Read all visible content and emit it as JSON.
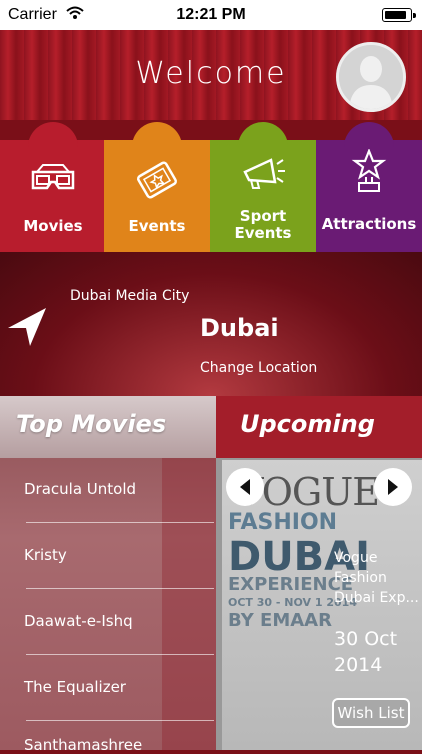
{
  "status": {
    "carrier": "Carrier",
    "time": "12:21 PM",
    "battery_level": 0.9
  },
  "header": {
    "title": "Welcome"
  },
  "categories": [
    {
      "label": "Movies",
      "icon": "3d-glasses-icon"
    },
    {
      "label": "Events",
      "icon": "ticket-icon"
    },
    {
      "label": "Sport Events",
      "icon": "megaphone-icon"
    },
    {
      "label": "Attractions",
      "icon": "star-trophy-icon"
    }
  ],
  "location": {
    "area": "Dubai Media City",
    "city": "Dubai",
    "change_label": "Change Location"
  },
  "top_movies": {
    "title": "Top Movies",
    "items": [
      "Dracula Untold",
      "Kristy",
      "Daawat-e-Ishq",
      "The Equalizer",
      "Santhamashree"
    ]
  },
  "upcoming": {
    "title": "Upcoming",
    "event": {
      "title": "Vogue Fashion Dubai Exp...",
      "date": "30 Oct 2014",
      "wish_label": "Wish List"
    },
    "poster": {
      "line1": "VOGUE",
      "line2": "FASHION",
      "line3": "DUBAI",
      "line4": "EXPERIENCE",
      "line5": "OCT 30 - NOV 1 2014",
      "line6": "BY EMAAR"
    }
  }
}
